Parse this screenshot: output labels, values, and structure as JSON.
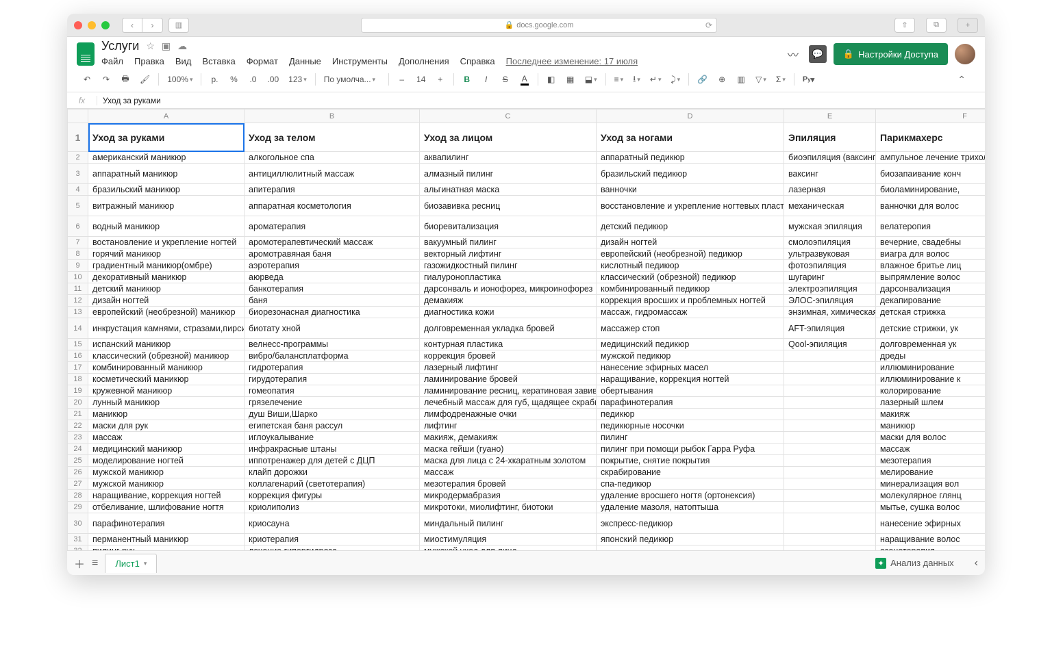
{
  "browser": {
    "url": "docs.google.com"
  },
  "doc": {
    "title": "Услуги",
    "menus": [
      "Файл",
      "Правка",
      "Вид",
      "Вставка",
      "Формат",
      "Данные",
      "Инструменты",
      "Дополнения",
      "Справка"
    ],
    "last_edit": "Последнее изменение: 17 июля",
    "share": "Настройки Доступа"
  },
  "toolbar": {
    "zoom": "100%",
    "currency": "р.",
    "percent": "%",
    "dec_less": ".0",
    "dec_more": ".00",
    "numfmt": "123",
    "font": "По умолча...",
    "size": "14"
  },
  "fx": {
    "value": "Уход за руками"
  },
  "columns": [
    "A",
    "B",
    "C",
    "D",
    "E",
    "F"
  ],
  "headers_row": [
    "Уход за руками",
    "Уход за телом",
    "Уход за лицом",
    "Уход за ногами",
    "Эпиляция",
    "Парикмахерс"
  ],
  "rows": [
    [
      "американский маникюр",
      "алкогольное спа",
      "аквапилинг",
      "аппаратный педикюр",
      "биоэпиляция (ваксинг)",
      "ампульное лечение трихолог"
    ],
    [
      "аппаратный маникюр",
      "антициллюлитный массаж",
      "алмазный пилинг",
      "бразильский педикюр",
      "ваксинг",
      "биозапаивание конч"
    ],
    [
      "бразильский маникюр",
      "апитерапия",
      "альгинатная маска",
      "ванночки",
      "лазерная",
      "биоламинирование,"
    ],
    [
      "витражный маникюр",
      "аппаратная косметология",
      "биозавивка ресниц",
      "восстановление и укрепление ногтевых пластин",
      "механическая",
      "ванночки для волос"
    ],
    [
      "водный маникюр",
      "ароматерапия",
      "биоревитализация",
      "детский педикюр",
      "мужская эпиляция",
      "велатеропия"
    ],
    [
      "востановление и укрепление ногтей",
      "аромотерапевтический массаж",
      "вакуумный пилинг",
      "дизайн ногтей",
      "смолоэпиляция",
      "вечерние, свадебны"
    ],
    [
      "горячий маникюр",
      "аромотравяная баня",
      "векторный лифтинг",
      "европейский (необрезной) педикюр",
      "ультразвуковая",
      "виагра для волос"
    ],
    [
      "градиентный маникюр(омбре)",
      "аэротерапия",
      "газожидкостный пилинг",
      "кислотный педикюр",
      "фотоэпиляция",
      "влажное бритье лиц"
    ],
    [
      "декоративный маникюр",
      "аюрведа",
      "гиалуронопластика",
      "классический (обрезной) педикюр",
      "шугаринг",
      "выпрямление волос"
    ],
    [
      "детский маникюр",
      "банкотерапия",
      "дарсонваль и ионофорез, микроинофорез",
      "комбинированный педикюр",
      "электроэпиляция",
      "дарсонвализация"
    ],
    [
      "дизайн ногтей",
      "баня",
      "демакияж",
      "коррекция вросших и проблемных ногтей",
      "ЭЛОС-эпиляция",
      "декапирование"
    ],
    [
      "европейский (необрезной) маникюр",
      "биорезонасная диагностика",
      "диагностика кожи",
      "массаж, гидромассаж",
      "энзимная, химическая",
      "детская стрижка"
    ],
    [
      "инкрустация камнями, стразами,пирсинг ногтей",
      "биотату хной",
      "долговременная укладка бровей",
      "массажер стоп",
      "AFT-эпиляция",
      "детские стрижки, ук"
    ],
    [
      "испанский маникюр",
      "велнесс-программы",
      "контурная пластика",
      "медицинский педикюр",
      "Qool-эпиляция",
      "долговременная ук"
    ],
    [
      "классический (обрезной) маникюр",
      "вибро/балансплатформа",
      "коррекция бровей",
      "мужской педикюр",
      "",
      "дреды"
    ],
    [
      "комбинированный маникюр",
      "гидротерапия",
      "лазерный лифтинг",
      "нанесение эфирных масел",
      "",
      "иллюминирование"
    ],
    [
      "косметический маникюр",
      "гирудотерапия",
      "ламинирование бровей",
      "наращивание, коррекция ногтей",
      "",
      "иллюминирование к"
    ],
    [
      "кружевной маникюр",
      "гомеопатия",
      "ламинирование ресниц, кератиновая завивка",
      "обертывания",
      "",
      "колорирование"
    ],
    [
      "лунный маникюр",
      "грязелечение",
      "лечебный массаж для губ, щадящее скрабирование",
      "парафинотерапия",
      "",
      "лазерный шлем"
    ],
    [
      "маникюр",
      "душ Виши,Шарко",
      "лимфодренажные очки",
      "педикюр",
      "",
      "макияж"
    ],
    [
      "маски для рук",
      "египетская баня рассул",
      "лифтинг",
      "педикюрные носочки",
      "",
      "маникюр"
    ],
    [
      "массаж",
      "иглоукалывание",
      "макияж, демакияж",
      "пилинг",
      "",
      "маски для волос"
    ],
    [
      "медицинский маникюр",
      "инфракрасные штаны",
      "маска гейши (гуано)",
      "пилинг при помощи рыбок Гарра Руфа",
      "",
      "массаж"
    ],
    [
      "моделирование ногтей",
      "иппотренажер для детей с ДЦП",
      "маска для лица с 24-хкаратным золотом",
      "покрытие, снятие покрытия",
      "",
      "мезотерапия"
    ],
    [
      "мужской маникюр",
      "клайп дорожки",
      "массаж",
      "скрабирование",
      "",
      "мелирование"
    ],
    [
      "мужской маникюр",
      "коллагенарий (светотерапия)",
      "мезотерапия бровей",
      "спа-педикюр",
      "",
      "минерализация вол"
    ],
    [
      "наращивание, коррекция ногтей",
      "коррекция фигуры",
      "микродермабразия",
      "удаление вросшего ногтя (ортонексия)",
      "",
      "молекулярное глянц"
    ],
    [
      "отбеливание, шлифование ногтя",
      "криолиполиз",
      "микротоки, миолифтинг, биотоки",
      "удаление мазоля, натоптыша",
      "",
      "мытье, сушка волос"
    ],
    [
      "парафинотерапия",
      "криосауна",
      "миндальный пилинг",
      "экспресс-педикюр",
      "",
      "нанесение эфирных"
    ],
    [
      "перманентный маникюр",
      "криотерапия",
      "миостимуляция",
      "японский педикюр",
      "",
      "наращивание волос"
    ],
    [
      "пилинг рук",
      "лечение гипергидроза",
      "мужской уход для лица",
      "",
      "",
      "озонотерапия"
    ]
  ],
  "tall_rows": [
    1,
    3,
    4,
    12,
    28
  ],
  "footer": {
    "sheet": "Лист1",
    "explore": "Анализ данных"
  }
}
